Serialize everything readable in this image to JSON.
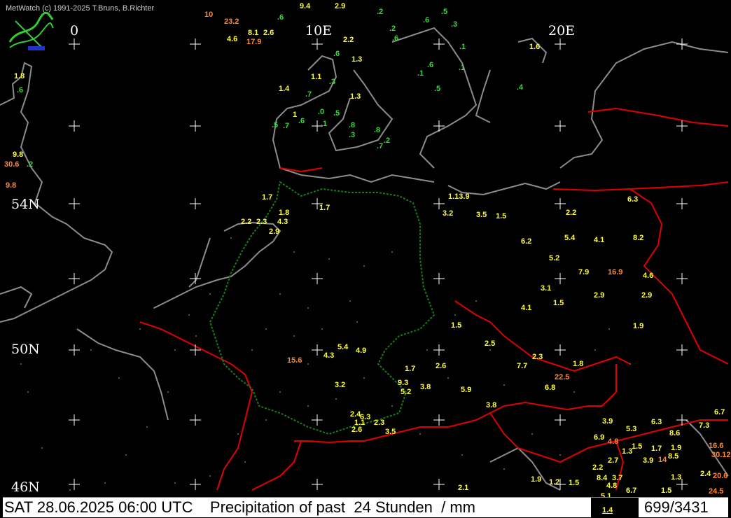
{
  "credit": "MetWatch  (c) 1991-2025 T.Bruns, B.Richter",
  "lon_labels": [
    "0",
    "10E",
    "20E"
  ],
  "lat_labels": [
    "54N",
    "50N",
    "46N"
  ],
  "status": {
    "title": "SAT 28.06.2025 06:00 UTC    Precipitation of past  24 Stunden  / mm",
    "legend_value": "1.4",
    "counter": "699/3431"
  },
  "colors": {
    "background": "#000000",
    "coast": "#8c8c8c",
    "border": "#e00000",
    "grid": "#ffffff",
    "low": "#33dd33",
    "mid": "#ffff33",
    "high": "#ff8833",
    "de_border": "#1a7a1a"
  },
  "obs": [
    {
      "v": "2.9",
      "c": "mid"
    },
    {
      "v": "9.4",
      "c": "mid"
    },
    {
      "v": "10",
      "c": "high"
    },
    {
      "v": "23.2",
      "c": "high"
    },
    {
      "v": "8.1",
      "c": "mid"
    },
    {
      "v": "2.6",
      "c": "mid"
    },
    {
      "v": "4.6",
      "c": "mid"
    },
    {
      "v": "17.9",
      "c": "high"
    },
    {
      "v": ".6",
      "c": "low"
    },
    {
      "v": ".2",
      "c": "low"
    },
    {
      "v": "2.2",
      "c": "mid"
    },
    {
      "v": ".6",
      "c": "low"
    },
    {
      "v": ".3",
      "c": "low"
    },
    {
      "v": ".2",
      "c": "low"
    },
    {
      "v": ".6",
      "c": "low"
    },
    {
      "v": ".5",
      "c": "low"
    },
    {
      "v": ".1",
      "c": "low"
    },
    {
      "v": ".3",
      "c": "low"
    },
    {
      "v": ".1",
      "c": "low"
    },
    {
      "v": ".6",
      "c": "low"
    },
    {
      "v": "1.6",
      "c": "mid"
    },
    {
      "v": "1.3",
      "c": "mid"
    },
    {
      "v": ".6",
      "c": "low"
    },
    {
      "v": ".1",
      "c": "low"
    },
    {
      "v": ".5",
      "c": "low"
    },
    {
      "v": ".4",
      "c": "low"
    },
    {
      "v": "1.8",
      "c": "mid"
    },
    {
      "v": ".6",
      "c": "low"
    },
    {
      "v": "1.1",
      "c": "mid"
    },
    {
      "v": "1.4",
      "c": "mid"
    },
    {
      "v": ".7",
      "c": "low"
    },
    {
      "v": "1.3",
      "c": "mid"
    },
    {
      "v": ".5",
      "c": "low"
    },
    {
      "v": ".0",
      "c": "low"
    },
    {
      "v": ".1",
      "c": "low"
    },
    {
      "v": "1",
      "c": "mid"
    },
    {
      "v": ".6",
      "c": "low"
    },
    {
      "v": ".5",
      "c": "low"
    },
    {
      "v": ".7",
      "c": "low"
    },
    {
      "v": ".8",
      "c": "low"
    },
    {
      "v": ".3",
      "c": "low"
    },
    {
      "v": ".8",
      "c": "low"
    },
    {
      "v": ".7",
      "c": "low"
    },
    {
      "v": ".2",
      "c": "low"
    },
    {
      "v": "9.8",
      "c": "mid"
    },
    {
      "v": "30.6",
      "c": "high"
    },
    {
      "v": ".2",
      "c": "low"
    },
    {
      "v": "9.8",
      "c": "high"
    },
    {
      "v": "54N",
      "c": "low"
    },
    {
      "v": "1.7",
      "c": "mid"
    },
    {
      "v": "1.8",
      "c": "mid"
    },
    {
      "v": "4.3",
      "c": "mid"
    },
    {
      "v": "2.2",
      "c": "mid"
    },
    {
      "v": "2.3",
      "c": "mid"
    },
    {
      "v": "2.9",
      "c": "mid"
    },
    {
      "v": "1.7",
      "c": "mid"
    },
    {
      "v": "1.13.9",
      "c": "mid"
    },
    {
      "v": "6.3",
      "c": "mid"
    },
    {
      "v": "3.2",
      "c": "mid"
    },
    {
      "v": "3.5",
      "c": "mid"
    },
    {
      "v": "1.5",
      "c": "mid"
    },
    {
      "v": "2.2",
      "c": "mid"
    },
    {
      "v": "6.2",
      "c": "mid"
    },
    {
      "v": "5.4",
      "c": "mid"
    },
    {
      "v": "4.1",
      "c": "mid"
    },
    {
      "v": "8.2",
      "c": "mid"
    },
    {
      "v": "5.2",
      "c": "mid"
    },
    {
      "v": "7.9",
      "c": "mid"
    },
    {
      "v": "16.9",
      "c": "high"
    },
    {
      "v": "4.6",
      "c": "mid"
    },
    {
      "v": "3.1",
      "c": "mid"
    },
    {
      "v": "2.9",
      "c": "mid"
    },
    {
      "v": "2.9",
      "c": "mid"
    },
    {
      "v": "4.1",
      "c": "mid"
    },
    {
      "v": "1.5",
      "c": "mid"
    },
    {
      "v": "1.9",
      "c": "mid"
    },
    {
      "v": "1.5",
      "c": "mid"
    },
    {
      "v": "2.5",
      "c": "mid"
    },
    {
      "v": "7.7",
      "c": "mid"
    },
    {
      "v": "2.3",
      "c": "mid"
    },
    {
      "v": "22.5",
      "c": "high"
    },
    {
      "v": "6.8",
      "c": "mid"
    },
    {
      "v": "1.8",
      "c": "mid"
    },
    {
      "v": "5.9",
      "c": "mid"
    },
    {
      "v": "3.8",
      "c": "mid"
    },
    {
      "v": "3.9",
      "c": "mid"
    },
    {
      "v": "5.3",
      "c": "mid"
    },
    {
      "v": "6.3",
      "c": "mid"
    },
    {
      "v": "7.3",
      "c": "mid"
    },
    {
      "v": "6.7",
      "c": "mid"
    },
    {
      "v": "8.6",
      "c": "mid"
    },
    {
      "v": "16.6",
      "c": "high"
    },
    {
      "v": "30.12",
      "c": "high"
    },
    {
      "v": "14",
      "c": "high"
    },
    {
      "v": "20.6",
      "c": "high"
    },
    {
      "v": "24.5",
      "c": "high"
    },
    {
      "v": "15.6",
      "c": "high"
    },
    {
      "v": "4.9",
      "c": "mid"
    },
    {
      "v": "5.4",
      "c": "mid"
    },
    {
      "v": "4.3",
      "c": "mid"
    },
    {
      "v": "3.2",
      "c": "mid"
    },
    {
      "v": "9.3",
      "c": "mid"
    },
    {
      "v": "5.2",
      "c": "mid"
    },
    {
      "v": "3.8",
      "c": "mid"
    },
    {
      "v": "2.6",
      "c": "mid"
    },
    {
      "v": "1.7",
      "c": "mid"
    },
    {
      "v": "2.4",
      "c": "mid"
    },
    {
      "v": "6.3",
      "c": "mid"
    },
    {
      "v": "1.1",
      "c": "mid"
    },
    {
      "v": "2.3",
      "c": "mid"
    },
    {
      "v": "2.6",
      "c": "mid"
    },
    {
      "v": "3.5",
      "c": "mid"
    },
    {
      "v": "2.1",
      "c": "mid"
    },
    {
      "v": "1.9",
      "c": "mid"
    },
    {
      "v": "1.2",
      "c": "mid"
    },
    {
      "v": "1.5",
      "c": "mid"
    },
    {
      "v": "8.4",
      "c": "mid"
    },
    {
      "v": "3.7",
      "c": "mid"
    },
    {
      "v": "4.8",
      "c": "mid"
    },
    {
      "v": "5.1",
      "c": "mid"
    },
    {
      "v": "6.7",
      "c": "mid"
    },
    {
      "v": "2.7",
      "c": "mid"
    },
    {
      "v": "1.3",
      "c": "mid"
    },
    {
      "v": "3.9",
      "c": "mid"
    },
    {
      "v": "6.9",
      "c": "mid"
    },
    {
      "v": "4.8",
      "c": "high"
    },
    {
      "v": "1.5",
      "c": "mid"
    },
    {
      "v": "1.7",
      "c": "mid"
    },
    {
      "v": "1.9",
      "c": "mid"
    },
    {
      "v": "8.5",
      "c": "mid"
    },
    {
      "v": "2.2",
      "c": "mid"
    },
    {
      "v": "1.3",
      "c": "mid"
    },
    {
      "v": "2.4",
      "c": "mid"
    },
    {
      "v": "1.5",
      "c": "mid"
    }
  ]
}
